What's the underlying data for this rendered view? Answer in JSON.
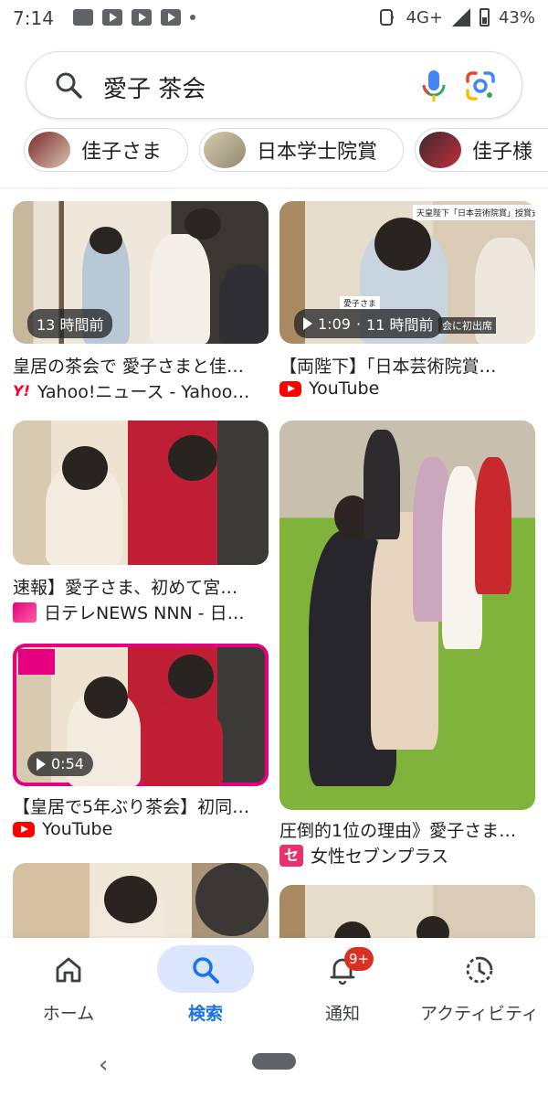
{
  "status_bar": {
    "time": "7:14",
    "network": "4G+",
    "battery": "43%"
  },
  "search": {
    "query": "愛子 茶会"
  },
  "chips": [
    {
      "label": "佳子さま"
    },
    {
      "label": "日本学士院賞"
    },
    {
      "label": "佳子様"
    }
  ],
  "results": [
    {
      "title": "皇居の茶会で 愛子さまと佳…",
      "source": "Yahoo!ニュース - Yahoo…",
      "badge": "13 時間前",
      "favicon": "yahoo-icon"
    },
    {
      "title": "【両陛下】「日本芸術院賞…",
      "source": "YouTube",
      "badge_duration": "1:09",
      "badge_time": "11 時間前",
      "overlay_tag": "天皇陛下「日本芸術院賞」授賞式",
      "overlay_name": "愛子さま",
      "overlay_caption": "会に初出席",
      "favicon": "youtube-icon"
    },
    {
      "title": "速報】愛子さま、初めて宮…",
      "source": "日テレNEWS NNN - 日…",
      "favicon": "ntv-icon"
    },
    {
      "title": "圧倒的1位の理由》愛子さま…",
      "source": "女性セブンプラス",
      "favicon": "seven-icon",
      "favicon_text": "セ"
    },
    {
      "title": "【皇居で5年ぶり茶会】初同…",
      "source": "YouTube",
      "badge_duration": "0:54",
      "favicon": "youtube-icon"
    }
  ],
  "bottom_nav": {
    "home": "ホーム",
    "search": "検索",
    "notifications": "通知",
    "notifications_badge": "9+",
    "activity": "アクティビティ"
  },
  "colors": {
    "accent": "#1a73e8",
    "active_pill": "#dbe6fc",
    "badge_red": "#d93025",
    "youtube_red": "#ff0000"
  }
}
